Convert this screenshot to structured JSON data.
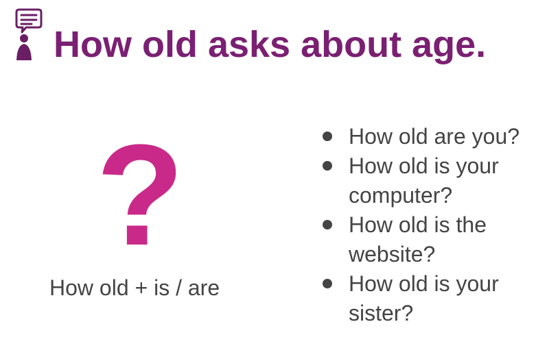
{
  "slide": {
    "title": "How old asks about age.",
    "icon": "speaking-person-icon",
    "symbol": "?",
    "formula": "How old + is / are",
    "examples": [
      "How old are you?",
      "How old is your computer?",
      "How old is the website?",
      "How old is your sister?"
    ]
  },
  "colors": {
    "title": "#7a2072",
    "question_mark": "#c92a8a",
    "body_text": "#444444"
  }
}
